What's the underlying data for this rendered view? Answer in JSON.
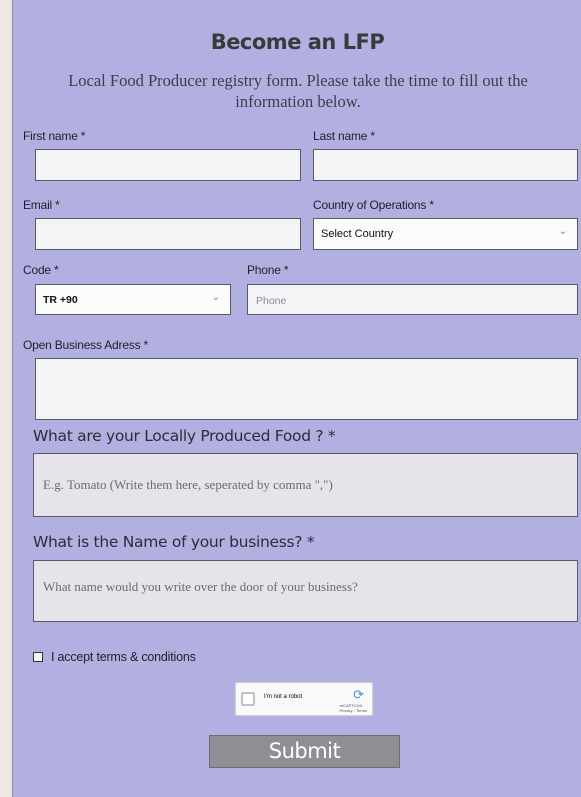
{
  "header": {
    "title": "Become an LFP",
    "subtitle": "Local Food Producer registry form. Please take the time to fill out the information below."
  },
  "fields": {
    "first_name_label": "First name *",
    "last_name_label": "Last name *",
    "email_label": "Email *",
    "country_label": "Country of Operations *",
    "country_value": "Select Country",
    "code_label": "Code *",
    "code_value": "TR +90",
    "phone_label": "Phone *",
    "phone_placeholder": "Phone",
    "address_label": "Open Business Adress *"
  },
  "questions": {
    "food_question": "What are your Locally Produced Food ? *",
    "food_placeholder": "E.g. Tomato (Write them here, seperated by comma \",\")",
    "business_question": "What is the Name of your business? *",
    "business_placeholder": "What name would you write over the door of your business?"
  },
  "terms": {
    "label": "I accept terms & conditions"
  },
  "recaptcha": {
    "label": "I'm not a robot",
    "brand": "reCAPTCHA",
    "links": "Privacy - Terms"
  },
  "submit": {
    "label": "Submit"
  },
  "icons": {
    "chevron": "chevron-down-icon",
    "recaptcha_logo": "recaptcha-logo-icon"
  }
}
